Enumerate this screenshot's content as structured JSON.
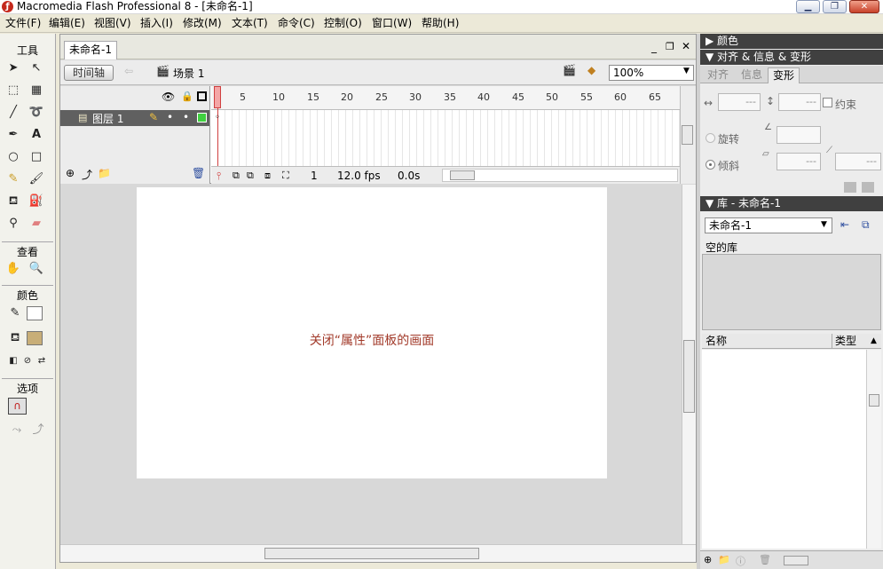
{
  "window": {
    "title": "Macromedia Flash Professional 8 - [未命名-1]"
  },
  "menu": [
    "文件(F)",
    "编辑(E)",
    "视图(V)",
    "插入(I)",
    "修改(M)",
    "文本(T)",
    "命令(C)",
    "控制(O)",
    "窗口(W)",
    "帮助(H)"
  ],
  "tools": {
    "section_tools": "工具",
    "section_view": "查看",
    "section_color": "颜色",
    "section_options": "选项"
  },
  "document": {
    "tab": "未命名-1",
    "timeline_button": "时间轴",
    "scene": "场景 1",
    "zoom": "100%"
  },
  "timeline": {
    "layer_name": "图层 1",
    "ruler_ticks": [
      "1",
      "5",
      "10",
      "15",
      "20",
      "25",
      "30",
      "35",
      "40",
      "45",
      "50",
      "55",
      "60",
      "65"
    ],
    "current_frame": "1",
    "fps": "12.0 fps",
    "time": "0.0s"
  },
  "stage": {
    "message": "关闭“属性”面板的画面"
  },
  "panels": {
    "color": "颜色",
    "align_info_transform": "对齐 & 信息 & 变形",
    "tabs": [
      "对齐",
      "信息",
      "变形"
    ],
    "transform": {
      "field_w": "---",
      "field_h": "---",
      "constrain": "约束",
      "rotate": "旋转",
      "skew": "倾斜",
      "rot_val": "",
      "skew_val1": "---",
      "skew_val2": "---"
    },
    "library_title": "库 - 未命名-1",
    "library_select": "未命名-1",
    "library_empty": "空的库",
    "col_name": "名称",
    "col_type": "类型"
  }
}
